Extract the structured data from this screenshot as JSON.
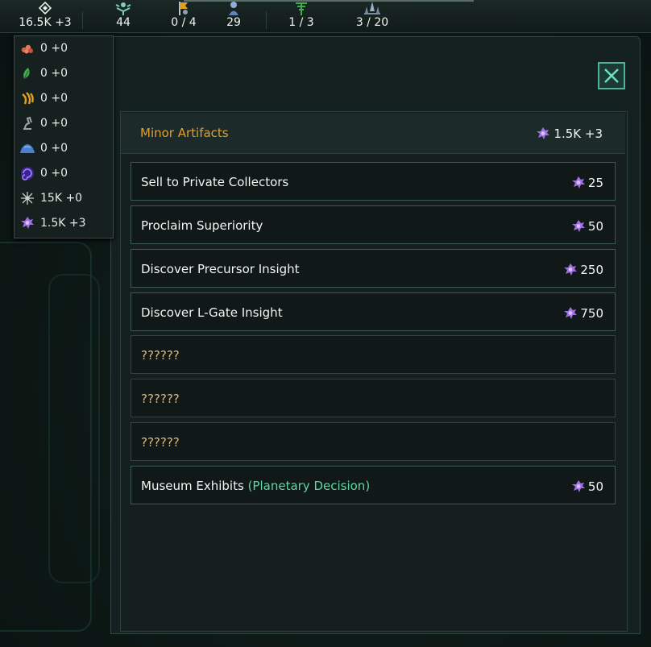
{
  "topbar": {
    "items": [
      {
        "icon": "energy-icon",
        "value": "16.5K +3"
      },
      {
        "icon": "influence-icon",
        "value": "44"
      },
      {
        "icon": "envoy-icon",
        "value": "0 / 4"
      },
      {
        "icon": "population-icon",
        "value": "29"
      },
      {
        "icon": "starbase-icon",
        "value": "1 / 3"
      },
      {
        "icon": "fleet-icon",
        "value": "3 / 20"
      }
    ]
  },
  "resources": [
    {
      "icon": "minerals-cluster-icon",
      "color": "#d9644a",
      "value": "0 +0"
    },
    {
      "icon": "leaf-icon",
      "color": "#3fae4a",
      "value": "0 +0"
    },
    {
      "icon": "exotic-gases-icon",
      "color": "#e0a020",
      "value": "0 +0"
    },
    {
      "icon": "research-icon",
      "color": "#9aa6a2",
      "value": "0 +0"
    },
    {
      "icon": "crystals-icon",
      "color": "#4a7ed0",
      "value": "0 +0"
    },
    {
      "icon": "dark-matter-icon",
      "color": "#6a4ad0",
      "value": "0 +0"
    },
    {
      "icon": "nanites-icon",
      "color": "#c8d0cc",
      "value": "15K +0"
    },
    {
      "icon": "minor-artifacts-icon",
      "color": "#a070e0",
      "value": "1.5K +3"
    }
  ],
  "panel": {
    "title": "Minor Artifacts",
    "amount": "1.5K +3",
    "options": [
      {
        "label": "Sell to Private Collectors",
        "suffix": "",
        "cost": "25"
      },
      {
        "label": "Proclaim Superiority",
        "suffix": "",
        "cost": "50"
      },
      {
        "label": "Discover Precursor Insight",
        "suffix": "",
        "cost": "250"
      },
      {
        "label": "Discover L-Gate Insight",
        "suffix": "",
        "cost": "750"
      },
      {
        "label": "??????",
        "suffix": "",
        "cost": ""
      },
      {
        "label": "??????",
        "suffix": "",
        "cost": ""
      },
      {
        "label": "??????",
        "suffix": "",
        "cost": ""
      },
      {
        "label": "Museum Exhibits",
        "suffix": "(Planetary Decision)",
        "cost": "50"
      }
    ]
  },
  "colors": {
    "accent": "#e0a030",
    "decision": "#5fd7a5",
    "artifact": "#a070e0",
    "close": "#4fb39a"
  }
}
